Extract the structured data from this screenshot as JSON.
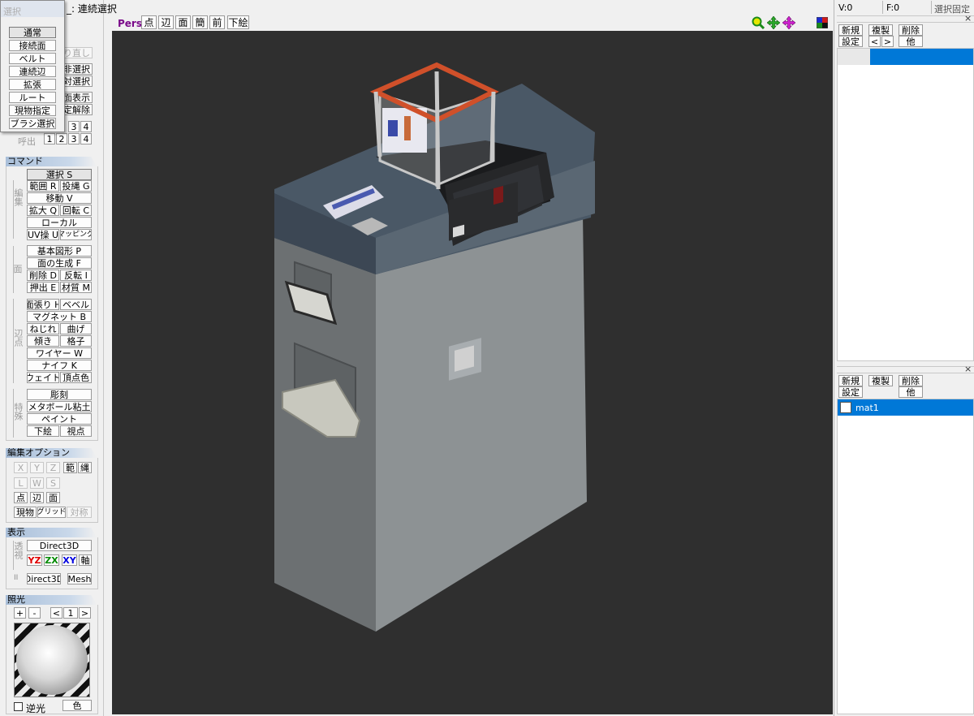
{
  "title_bar": {
    "mode_text": "連続選択"
  },
  "select_popup": {
    "title": "選択",
    "items": [
      "通常",
      "接続面",
      "ベルト",
      "連続辺",
      "拡張",
      "ルート",
      "現物指定",
      "ブラシ選択"
    ]
  },
  "left_hidden": {
    "undo_fragment": "り直し",
    "r1": "非選択",
    "r2": "対選択",
    "r3": "面表示",
    "r4": "定解除",
    "nums_top": [
      "3",
      "4"
    ],
    "recall_label": "呼出",
    "nums_bot": [
      "1",
      "2",
      "3",
      "4"
    ]
  },
  "command": {
    "header": "コマンド",
    "select": "選択 S",
    "group_edit_label": "編集",
    "range": "範囲 R",
    "lasso": "投縄 G",
    "move": "移動 V",
    "scale": "拡大 Q",
    "rotate": "回転 C",
    "local": "ローカル",
    "uv": "UV操 U",
    "mapping": "マッピング",
    "group_face_label": "面",
    "primitive": "基本図形 P",
    "face_gen": "面の生成 F",
    "delete": "削除 D",
    "flip": "反転 I",
    "extrude": "押出 E",
    "material": "材質 M",
    "group_edge_label": "辺点",
    "stretch": "面張り H",
    "bevel": "ベベル",
    "magnet": "マグネット B",
    "twist": "ねじれ",
    "bend": "曲げ",
    "tilt": "傾き",
    "lattice": "格子",
    "wire": "ワイヤー W",
    "knife": "ナイフ K",
    "weight": "ウェイト",
    "vcolor": "頂点色",
    "group_special_label": "特殊",
    "sculpt": "彫刻",
    "metaball": "メタボール粘土",
    "paint": "ペイント",
    "underlay": "下絵",
    "viewpoint": "視点"
  },
  "edit_options": {
    "header": "編集オプション",
    "x": "X",
    "y": "Y",
    "z": "Z",
    "range": "範",
    "lasso": "縄",
    "l": "L",
    "w": "W",
    "s": "S",
    "vertex": "点",
    "edge": "辺",
    "face": "面",
    "object": "現物",
    "grid": "グリッド",
    "symmetry": "対称"
  },
  "display": {
    "header": "表示",
    "group_label": "透視",
    "renderer": "Direct3D",
    "yz": "YZ",
    "zx": "ZX",
    "xy": "XY",
    "axis": "軸",
    "pause_label": "II",
    "renderer2": "Direct3D",
    "mesh": "Mesh",
    "colors": {
      "yz": "#e00000",
      "zx": "#008a00",
      "xy": "#0000e0"
    }
  },
  "lighting": {
    "header": "照光",
    "plus": "+",
    "minus": "-",
    "prev": "<",
    "index": "1",
    "next": ">",
    "backlight_label": "逆光",
    "color_label": "色"
  },
  "viewport_toolbar": {
    "mode": "Pers",
    "vertex": "点",
    "edge": "辺",
    "face": "面",
    "simple": "簡",
    "front": "前",
    "underlay": "下絵",
    "mode_color": "#7a0a8a"
  },
  "status": {
    "vertices": "V:0",
    "faces": "F:0",
    "select_lock": "選択固定"
  },
  "object_panel": {
    "new": "新規",
    "copy": "複製",
    "delete": "削除",
    "settings": "設定",
    "prev": "<",
    "next": ">",
    "other": "他",
    "close": "×"
  },
  "material_panel": {
    "new": "新規",
    "copy": "複製",
    "delete": "削除",
    "settings": "設定",
    "other": "他",
    "items": [
      "mat1"
    ],
    "close": "×"
  },
  "colors": {
    "selection": "#0078d7",
    "viewport_bg": "#2f2f2f"
  }
}
